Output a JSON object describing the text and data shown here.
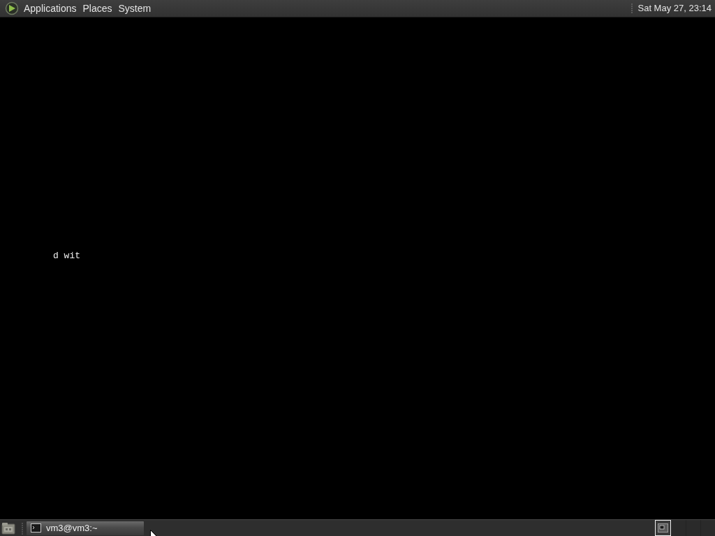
{
  "top_panel": {
    "menus": [
      {
        "label": "Applications"
      },
      {
        "label": "Places"
      },
      {
        "label": "System"
      }
    ],
    "clock": "Sat May 27, 23:14"
  },
  "desktop": {
    "terminal_fragment": "d wit"
  },
  "bottom_panel": {
    "tasks": [
      {
        "label": "vm3@vm3:~"
      }
    ],
    "workspaces": [
      {
        "selected": true,
        "occupied": true
      },
      {
        "selected": false,
        "occupied": false
      },
      {
        "selected": false,
        "occupied": false
      },
      {
        "selected": false,
        "occupied": false
      }
    ]
  }
}
